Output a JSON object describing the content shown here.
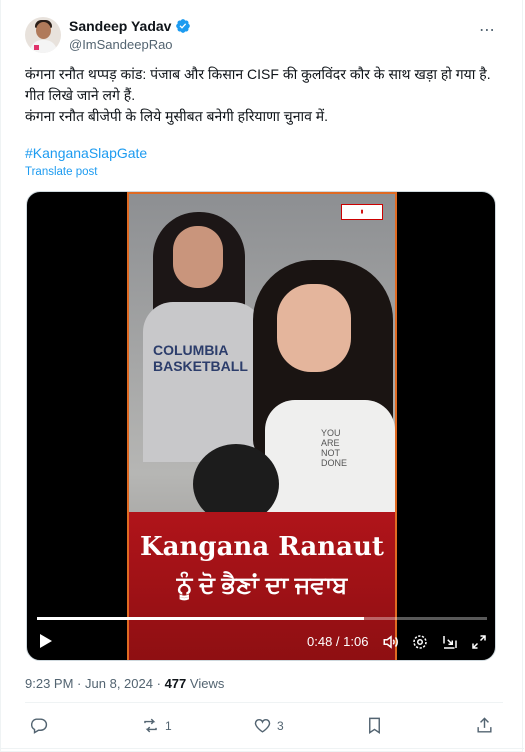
{
  "author": {
    "name": "Sandeep Yadav",
    "handle": "@ImSandeepRao",
    "verified": true
  },
  "more_icon": "⋯",
  "tweet": {
    "text": "कंगना रनौत थप्पड़ कांड: पंजाब और किसान CISF की कुलविंदर कौर के साथ खड़ा हो गया है. गीत लिखे जाने लगे हैं.\nकंगना रनौत बीजेपी के लिये मुसीबत बनेगी हरियाणा चुनाव में.",
    "hashtag": "#KanganaSlapGate",
    "translate_label": "Translate post"
  },
  "video": {
    "banner_title": "Kangana Ranaut",
    "banner_subtitle": "ਨੂੰ ਦੋ ਭੈਣਾਂ ਦਾ ਜਵਾਬ",
    "shirt_text_1": "COLUMBIA\nBASKETBALL",
    "shirt_text_2": "YOU\nARE\nNOT\nDONE",
    "time_display": "0:48 / 1:06",
    "progress": 0.727,
    "icons": {
      "play": "play-icon",
      "volume": "volume-icon",
      "settings": "settings-icon",
      "pip": "picture-in-picture-icon",
      "fullscreen": "fullscreen-icon"
    }
  },
  "meta": {
    "time": "9:23 PM",
    "date": "Jun 8, 2024",
    "separator": "·",
    "views_count": "477",
    "views_label": "Views"
  },
  "actions": {
    "reply": {
      "icon": "reply-icon",
      "count": ""
    },
    "retweet": {
      "icon": "retweet-icon",
      "count": "1"
    },
    "like": {
      "icon": "heart-icon",
      "count": "3"
    },
    "bookmark": {
      "icon": "bookmark-icon",
      "count": ""
    },
    "share": {
      "icon": "share-icon",
      "count": ""
    }
  },
  "colors": {
    "accent": "#1d9bf0",
    "text": "#0f1419",
    "muted": "#536471",
    "banner_red": "#b0141a",
    "frame_orange": "#e06a22"
  }
}
